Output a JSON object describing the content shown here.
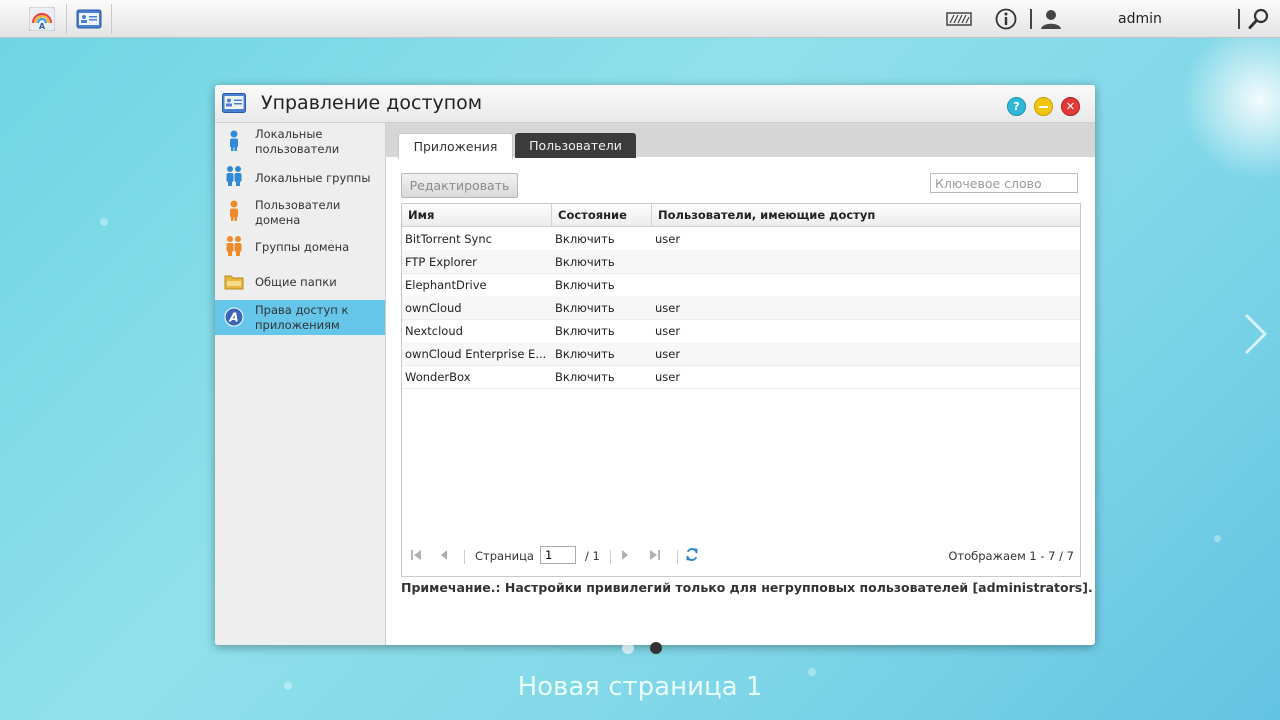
{
  "topbar": {
    "user": "admin"
  },
  "window": {
    "title": "Управление доступом",
    "tabs": [
      {
        "label": "Приложения",
        "selected": true
      },
      {
        "label": "Пользователи",
        "selected": false
      }
    ],
    "sidebar": [
      {
        "label": "Локальные пользователи",
        "icon": "user-icon",
        "active": false
      },
      {
        "label": "Локальные группы",
        "icon": "group-icon",
        "active": false
      },
      {
        "label": "Пользователи домена",
        "icon": "domain-user-icon",
        "active": false
      },
      {
        "label": "Группы домена",
        "icon": "domain-group-icon",
        "active": false
      },
      {
        "label": "Общие папки",
        "icon": "folder-icon",
        "active": false
      },
      {
        "label": "Права доступ к приложениям",
        "icon": "app-access-icon",
        "active": true
      }
    ],
    "edit_button": "Редактировать",
    "search_placeholder": "Ключевое слово",
    "columns": [
      "Имя",
      "Состояние",
      "Пользователи, имеющие доступ"
    ],
    "rows": [
      {
        "name": "BitTorrent Sync",
        "state": "Включить",
        "users": "user"
      },
      {
        "name": "FTP Explorer",
        "state": "Включить",
        "users": ""
      },
      {
        "name": "ElephantDrive",
        "state": "Включить",
        "users": ""
      },
      {
        "name": "ownCloud",
        "state": "Включить",
        "users": "user"
      },
      {
        "name": "Nextcloud",
        "state": "Включить",
        "users": "user"
      },
      {
        "name": "ownCloud Enterprise E...",
        "state": "Включить",
        "users": "user"
      },
      {
        "name": "WonderBox",
        "state": "Включить",
        "users": "user"
      }
    ],
    "pager": {
      "page_label": "Страница",
      "page_value": "1",
      "page_total": "/ 1",
      "display_info": "Отображаем 1 - 7 / 7"
    },
    "note": "Примечание.: Настройки привилегий только для негрупповых пользователей [administrators]."
  },
  "desktop": {
    "page_title": "Новая страница 1"
  },
  "colors": {
    "accent": "#65c6ea",
    "help": "#2fb8d8",
    "minimize": "#f2c40e",
    "close": "#e23a3a"
  }
}
